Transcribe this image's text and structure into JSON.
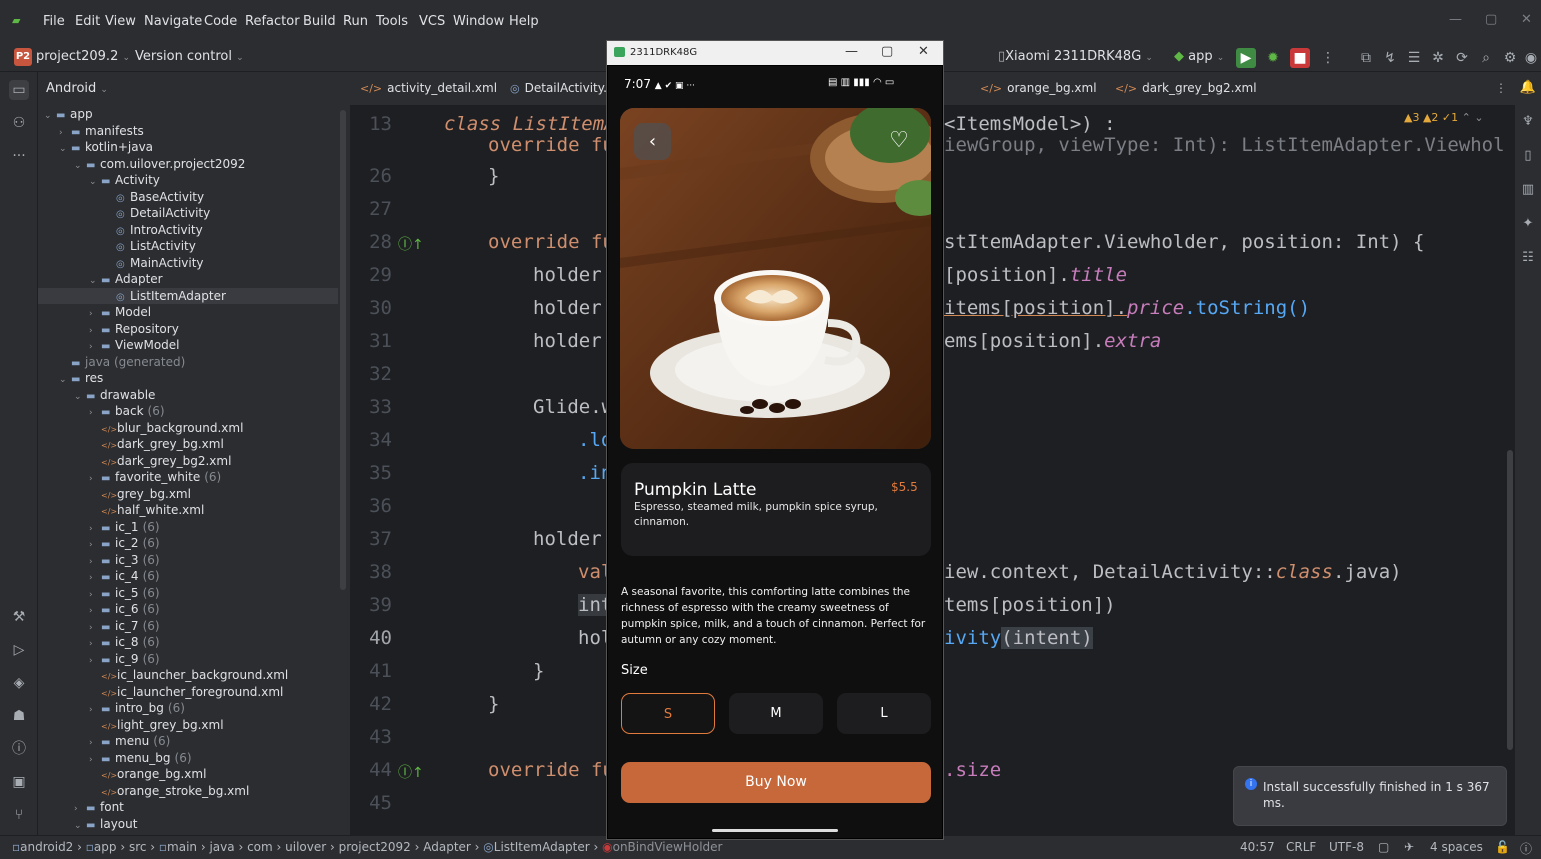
{
  "menu": [
    "File",
    "Edit",
    "View",
    "Navigate",
    "Code",
    "Refactor",
    "Build",
    "Run",
    "Tools",
    "VCS",
    "Window",
    "Help"
  ],
  "toolbar": {
    "project_badge": "P2",
    "project": "project209.2",
    "vcs": "Version control",
    "device": "Xiaomi 2311DRK48G",
    "run_config": "app"
  },
  "project_panel": {
    "title": "Android",
    "tree": [
      {
        "label": "app",
        "depth": 0,
        "arrow": "down",
        "icon": "folder"
      },
      {
        "label": "manifests",
        "depth": 1,
        "arrow": "right",
        "icon": "folder"
      },
      {
        "label": "kotlin+java",
        "depth": 1,
        "arrow": "down",
        "icon": "folder"
      },
      {
        "label": "com.uilover.project2092",
        "depth": 2,
        "arrow": "down",
        "icon": "folder"
      },
      {
        "label": "Activity",
        "depth": 3,
        "arrow": "down",
        "icon": "folder"
      },
      {
        "label": "BaseActivity",
        "depth": 4,
        "arrow": "",
        "icon": "class"
      },
      {
        "label": "DetailActivity",
        "depth": 4,
        "arrow": "",
        "icon": "class"
      },
      {
        "label": "IntroActivity",
        "depth": 4,
        "arrow": "",
        "icon": "class"
      },
      {
        "label": "ListActivity",
        "depth": 4,
        "arrow": "",
        "icon": "class"
      },
      {
        "label": "MainActivity",
        "depth": 4,
        "arrow": "",
        "icon": "class"
      },
      {
        "label": "Adapter",
        "depth": 3,
        "arrow": "down",
        "icon": "folder"
      },
      {
        "label": "ListItemAdapter",
        "depth": 4,
        "arrow": "",
        "icon": "class",
        "selected": true
      },
      {
        "label": "Model",
        "depth": 3,
        "arrow": "right",
        "icon": "folder"
      },
      {
        "label": "Repository",
        "depth": 3,
        "arrow": "right",
        "icon": "folder"
      },
      {
        "label": "ViewModel",
        "depth": 3,
        "arrow": "right",
        "icon": "folder"
      },
      {
        "label": "java (generated)",
        "depth": 1,
        "arrow": "",
        "icon": "folder",
        "dim": true
      },
      {
        "label": "res",
        "depth": 1,
        "arrow": "down",
        "icon": "folder"
      },
      {
        "label": "drawable",
        "depth": 2,
        "arrow": "down",
        "icon": "folder"
      },
      {
        "label": "back",
        "depth": 3,
        "arrow": "right",
        "icon": "folder",
        "count": "(6)"
      },
      {
        "label": "blur_background.xml",
        "depth": 3,
        "arrow": "",
        "icon": "xml"
      },
      {
        "label": "dark_grey_bg.xml",
        "depth": 3,
        "arrow": "",
        "icon": "xml"
      },
      {
        "label": "dark_grey_bg2.xml",
        "depth": 3,
        "arrow": "",
        "icon": "xml"
      },
      {
        "label": "favorite_white",
        "depth": 3,
        "arrow": "right",
        "icon": "folder",
        "count": "(6)"
      },
      {
        "label": "grey_bg.xml",
        "depth": 3,
        "arrow": "",
        "icon": "xml"
      },
      {
        "label": "half_white.xml",
        "depth": 3,
        "arrow": "",
        "icon": "xml"
      },
      {
        "label": "ic_1",
        "depth": 3,
        "arrow": "right",
        "icon": "folder",
        "count": "(6)"
      },
      {
        "label": "ic_2",
        "depth": 3,
        "arrow": "right",
        "icon": "folder",
        "count": "(6)"
      },
      {
        "label": "ic_3",
        "depth": 3,
        "arrow": "right",
        "icon": "folder",
        "count": "(6)"
      },
      {
        "label": "ic_4",
        "depth": 3,
        "arrow": "right",
        "icon": "folder",
        "count": "(6)"
      },
      {
        "label": "ic_5",
        "depth": 3,
        "arrow": "right",
        "icon": "folder",
        "count": "(6)"
      },
      {
        "label": "ic_6",
        "depth": 3,
        "arrow": "right",
        "icon": "folder",
        "count": "(6)"
      },
      {
        "label": "ic_7",
        "depth": 3,
        "arrow": "right",
        "icon": "folder",
        "count": "(6)"
      },
      {
        "label": "ic_8",
        "depth": 3,
        "arrow": "right",
        "icon": "folder",
        "count": "(6)"
      },
      {
        "label": "ic_9",
        "depth": 3,
        "arrow": "right",
        "icon": "folder",
        "count": "(6)"
      },
      {
        "label": "ic_launcher_background.xml",
        "depth": 3,
        "arrow": "",
        "icon": "xml"
      },
      {
        "label": "ic_launcher_foreground.xml",
        "depth": 3,
        "arrow": "",
        "icon": "xml"
      },
      {
        "label": "intro_bg",
        "depth": 3,
        "arrow": "right",
        "icon": "folder",
        "count": "(6)"
      },
      {
        "label": "light_grey_bg.xml",
        "depth": 3,
        "arrow": "",
        "icon": "xml"
      },
      {
        "label": "menu",
        "depth": 3,
        "arrow": "right",
        "icon": "folder",
        "count": "(6)"
      },
      {
        "label": "menu_bg",
        "depth": 3,
        "arrow": "right",
        "icon": "folder",
        "count": "(6)"
      },
      {
        "label": "orange_bg.xml",
        "depth": 3,
        "arrow": "",
        "icon": "xml"
      },
      {
        "label": "orange_stroke_bg.xml",
        "depth": 3,
        "arrow": "",
        "icon": "xml"
      },
      {
        "label": "font",
        "depth": 2,
        "arrow": "right",
        "icon": "folder"
      },
      {
        "label": "layout",
        "depth": 2,
        "arrow": "down",
        "icon": "folder"
      }
    ]
  },
  "editor_tabs": [
    "activity_detail.xml",
    "DetailActivity.",
    "orange_bg.xml",
    "dark_grey_bg2.xml"
  ],
  "inspections": "▲3 ▲2 ✓1",
  "line_numbers": [
    "13",
    "26",
    "27",
    "28",
    "29",
    "30",
    "31",
    "32",
    "33",
    "34",
    "35",
    "36",
    "37",
    "38",
    "39",
    "40",
    "41",
    "42",
    "43",
    "44",
    "45"
  ],
  "current_line": "40",
  "code": {
    "l13a": "class ListItemA",
    "l13b": "<ItemsModel>) :",
    "l20a": "override fu",
    "l20b": "iewGroup, viewType: Int): ListItemAdapter.Viewhold",
    "l26": "}",
    "l28a": "override fu",
    "l28b": "stItemAdapter.Viewholder, position: Int) {",
    "l29a": "holder.",
    "l29b": "[position].",
    "l29c": "title",
    "l30a": "holder.",
    "l30b": "items[position].",
    "l30c": "price",
    "l30d": ".toString()",
    "l31a": "holder.",
    "l31b": "ems[position].",
    "l31c": "extra",
    "l33": "Glide.w",
    "l34": ".lo",
    "l35": ".in",
    "l37": "holder.",
    "l38a": "val",
    "l38b": "iew.context, DetailActivity::",
    "l38c": "class",
    "l38d": ".java)",
    "l39a": "int",
    "l39b": "tems[position])",
    "l40a": "hol",
    "l40b": "ivity",
    "l40c": "(intent)",
    "l41": "}",
    "l42": "}",
    "l44a": "override fu",
    "l44b": ".size"
  },
  "status_bar": {
    "breadcrumbs": [
      "android2",
      "app",
      "src",
      "main",
      "java",
      "com",
      "uilover",
      "project2092",
      "Adapter",
      "ListItemAdapter",
      "onBindViewHolder"
    ],
    "position": "40:57",
    "line_sep": "CRLF",
    "encoding": "UTF-8",
    "indent": "4 spaces"
  },
  "toast": {
    "message": "Install successfully finished in 1 s 367 ms."
  },
  "emulator": {
    "title": "2311DRK48G",
    "phone_time": "7:07",
    "phone_status_left": "▲ ✔ ▣ ···",
    "phone_status_right": "▤ ▥ ▮▮▮ ◠ ▭",
    "product": {
      "title": "Pumpkin Latte",
      "price": "$5.5",
      "extra": "Espresso, steamed milk, pumpkin spice syrup, cinnamon.",
      "description": "A seasonal favorite, this comforting latte combines the richness of espresso with the creamy sweetness of pumpkin spice, milk, and a touch of cinnamon. Perfect for autumn or any cozy moment."
    },
    "size_label": "Size",
    "sizes": [
      "S",
      "M",
      "L"
    ],
    "selected_size": "S",
    "buy_label": "Buy Now"
  },
  "colors": {
    "accent": "#e07a3d",
    "buy_button": "#c6683a",
    "ide_bg": "#1e1f22",
    "panel_bg": "#2b2d30"
  }
}
